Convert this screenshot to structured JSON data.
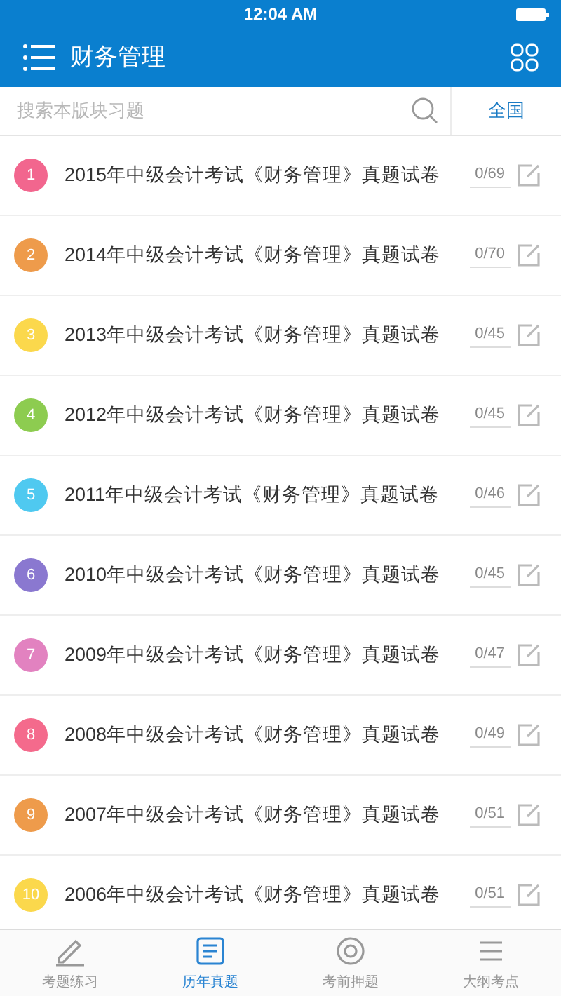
{
  "status_bar": {
    "time": "12:04 AM"
  },
  "header": {
    "title": "财务管理"
  },
  "search": {
    "placeholder": "搜索本版块习题",
    "region": "全国"
  },
  "items": [
    {
      "number": "1",
      "color": "#f2668e",
      "title": "2015年中级会计考试《财务管理》真题试卷",
      "progress": "0/69"
    },
    {
      "number": "2",
      "color": "#ee9b4b",
      "title": "2014年中级会计考试《财务管理》真题试卷",
      "progress": "0/70"
    },
    {
      "number": "3",
      "color": "#fbd84c",
      "title": "2013年中级会计考试《财务管理》真题试卷",
      "progress": "0/45"
    },
    {
      "number": "4",
      "color": "#8dcc50",
      "title": "2012年中级会计考试《财务管理》真题试卷",
      "progress": "0/45"
    },
    {
      "number": "5",
      "color": "#4fc9f0",
      "title": "2011年中级会计考试《财务管理》真题试卷",
      "progress": "0/46"
    },
    {
      "number": "6",
      "color": "#8a78d0",
      "title": "2010年中级会计考试《财务管理》真题试卷",
      "progress": "0/45"
    },
    {
      "number": "7",
      "color": "#e282c0",
      "title": "2009年中级会计考试《财务管理》真题试卷",
      "progress": "0/47"
    },
    {
      "number": "8",
      "color": "#f46a8c",
      "title": "2008年中级会计考试《财务管理》真题试卷",
      "progress": "0/49"
    },
    {
      "number": "9",
      "color": "#ee9b4b",
      "title": "2007年中级会计考试《财务管理》真题试卷",
      "progress": "0/51"
    },
    {
      "number": "10",
      "color": "#fbd84c",
      "title": "2006年中级会计考试《财务管理》真题试卷",
      "progress": "0/51"
    }
  ],
  "tabs": [
    {
      "label": "考题练习",
      "kind": "pencil",
      "selected": false
    },
    {
      "label": "历年真题",
      "kind": "paper",
      "selected": true
    },
    {
      "label": "考前押题",
      "kind": "target",
      "selected": false
    },
    {
      "label": "大纲考点",
      "kind": "outline",
      "selected": false
    }
  ]
}
